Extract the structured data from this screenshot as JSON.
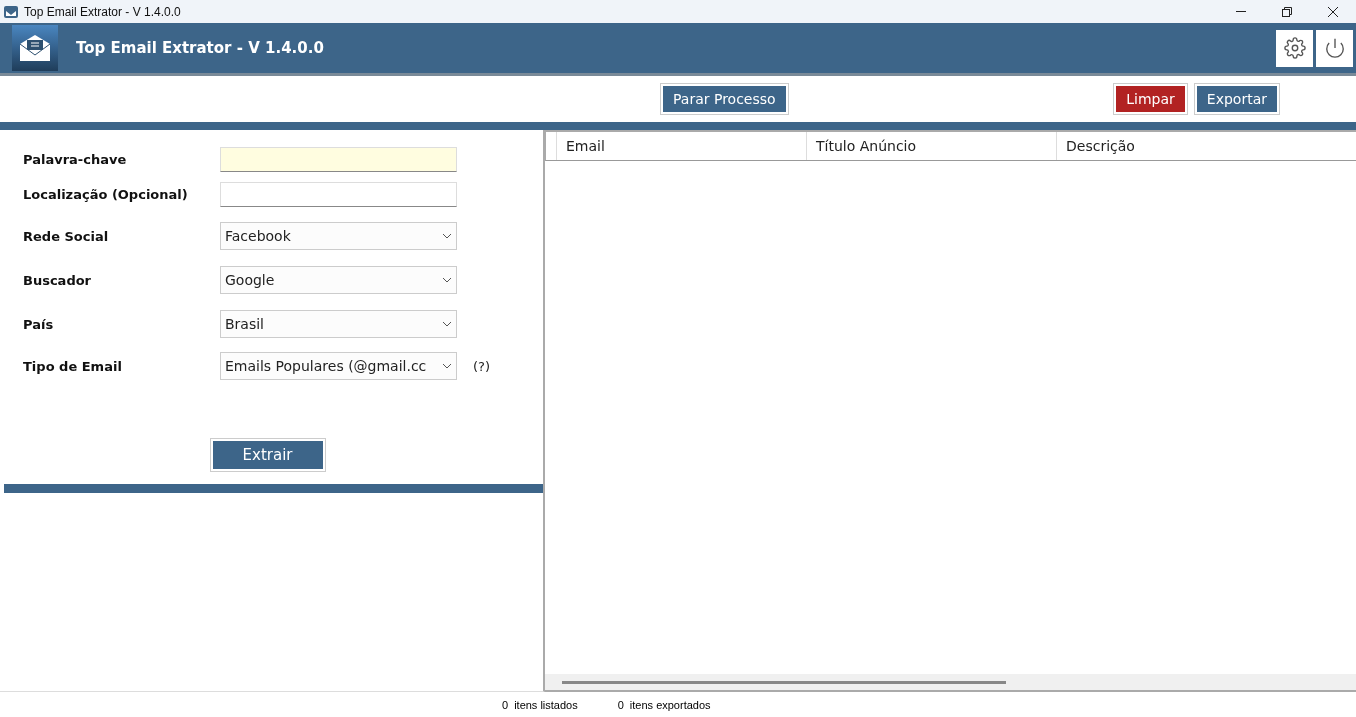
{
  "window": {
    "title": "Top Email Extrator - V 1.4.0.0"
  },
  "header": {
    "title": "Top Email Extrator - V 1.4.0.0"
  },
  "toolbar": {
    "center_button": "Parar Processo",
    "buttons": [
      {
        "label": "Limpar",
        "kind": "danger"
      },
      {
        "label": "Exportar",
        "kind": "primary"
      }
    ]
  },
  "form": {
    "fields": [
      {
        "label": "Palavra-chave",
        "kind": "text",
        "highlighted": true
      },
      {
        "label": "Localização (Opcional)",
        "kind": "text",
        "highlighted": false
      },
      {
        "label": "Rede Social",
        "kind": "select",
        "value": "Facebook"
      },
      {
        "label": "Buscador",
        "kind": "select",
        "value": "Google"
      },
      {
        "label": "País",
        "kind": "select",
        "value": "Brasil"
      },
      {
        "label": "Tipo de Email",
        "kind": "select",
        "value": "Emails Populares (@gmail.cc",
        "help": "(?)"
      }
    ],
    "submit": "Extrair"
  },
  "table": {
    "columns": [
      "Email",
      "Título Anúncio",
      "Descrição"
    ]
  },
  "status_bar": [
    {
      "count": "0",
      "label": "itens listados"
    },
    {
      "count": "0",
      "label": "itens exportados"
    }
  ]
}
